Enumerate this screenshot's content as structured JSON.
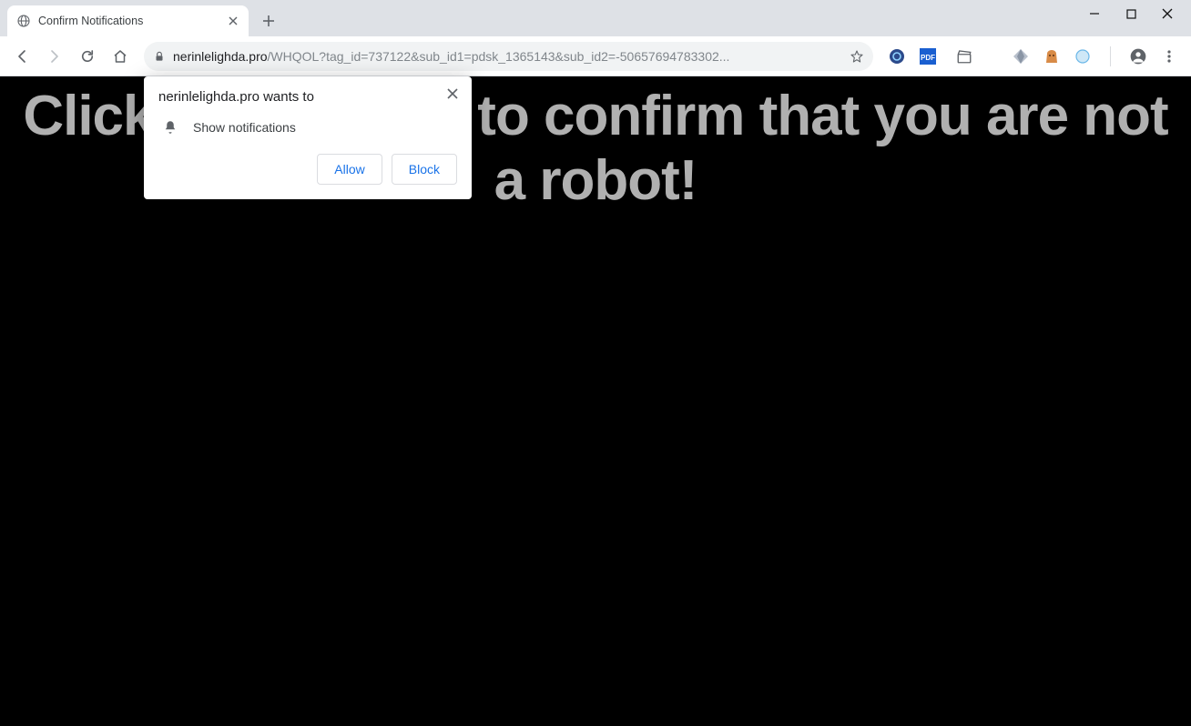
{
  "window": {
    "tab_title": "Confirm Notifications"
  },
  "address": {
    "domain": "nerinlelighda.pro",
    "path": "/WHQOL?tag_id=737122&sub_id1=pdsk_1365143&sub_id2=-50657694783302..."
  },
  "page": {
    "headline": "Click the \"Allow\" to confirm that you are not a robot!"
  },
  "permission_prompt": {
    "origin_wants": "nerinlelighda.pro wants to",
    "capability": "Show notifications",
    "allow": "Allow",
    "block": "Block"
  },
  "extensions": {
    "e1": "extension-circle-blue",
    "e2": "extension-pdf",
    "e3": "extension-clapper",
    "e4": "extension-diamond",
    "e5": "extension-bag",
    "e6": "extension-bubble"
  }
}
